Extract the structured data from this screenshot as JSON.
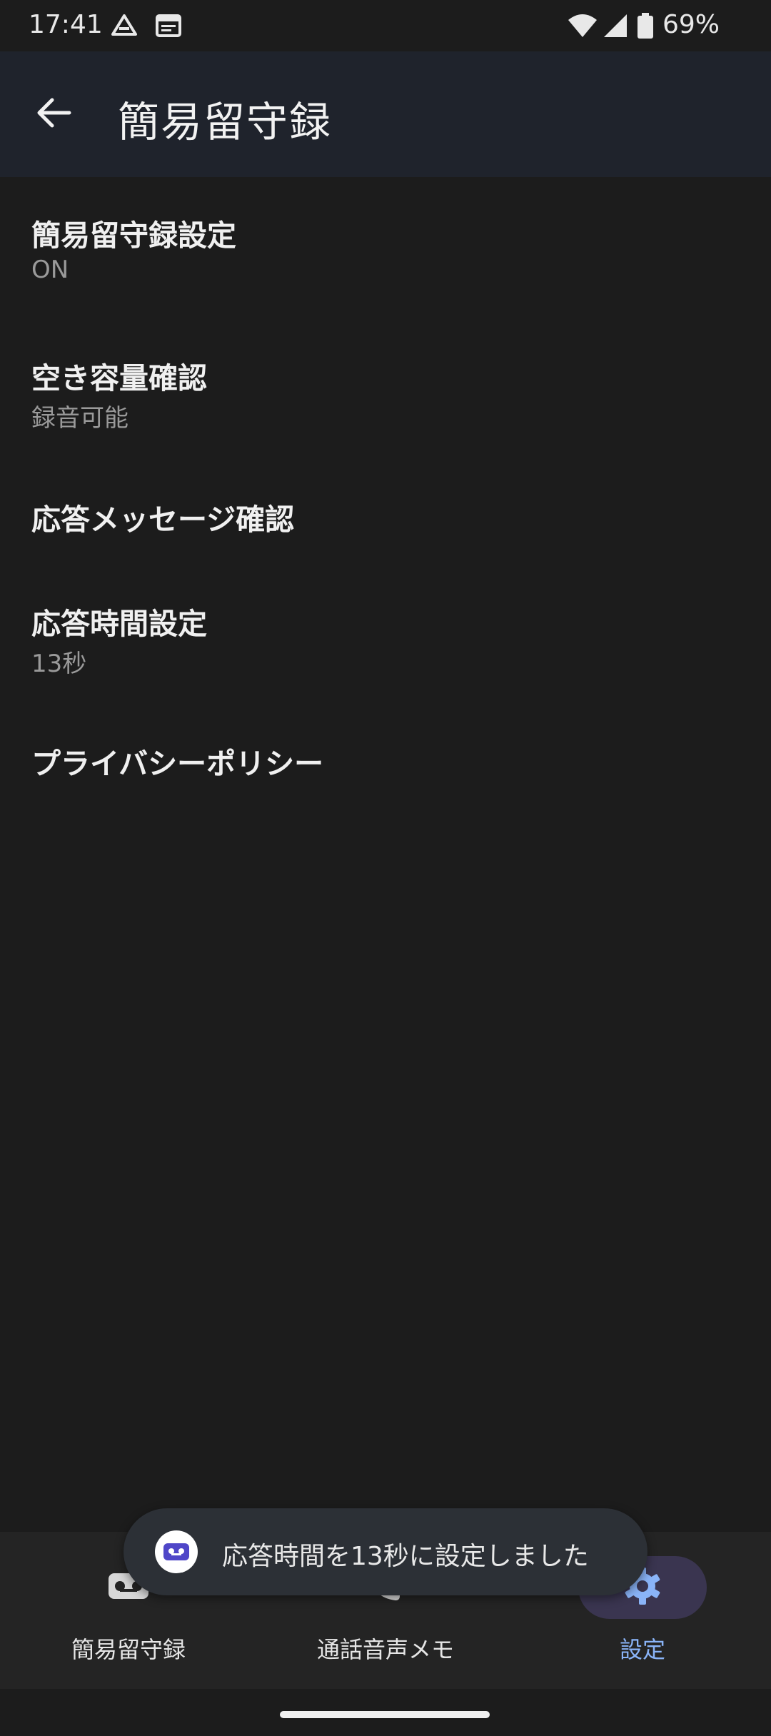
{
  "status_bar": {
    "time": "17:41",
    "battery_text": "69%",
    "icons": [
      "drive-icon",
      "calendar-icon",
      "wifi-icon",
      "signal-icon",
      "battery-icon"
    ]
  },
  "app_bar": {
    "title": "簡易留守録",
    "back_icon": "arrow-back-icon"
  },
  "settings": [
    {
      "title": "簡易留守録設定",
      "subtitle": "ON"
    },
    {
      "title": "空き容量確認",
      "subtitle": "録音可能"
    },
    {
      "title": "応答メッセージ確認",
      "subtitle": ""
    },
    {
      "title": "応答時間設定",
      "subtitle": "13秒"
    },
    {
      "title": "プライバシーポリシー",
      "subtitle": ""
    }
  ],
  "bottom_nav": [
    {
      "label": "簡易留守録",
      "icon": "voicemail-icon",
      "active": false
    },
    {
      "label": "通話音声メモ",
      "icon": "phone-icon",
      "active": false
    },
    {
      "label": "設定",
      "icon": "gear-icon",
      "active": true
    }
  ],
  "toast": {
    "text": "応答時間を13秒に設定しました",
    "icon": "voicemail-icon"
  },
  "colors": {
    "background": "#1c1c1c",
    "app_bar": "#1f232c",
    "accent": "#8ab4f8",
    "active_pill": "#3a3550",
    "toast_icon_fg": "#4f46c8"
  }
}
